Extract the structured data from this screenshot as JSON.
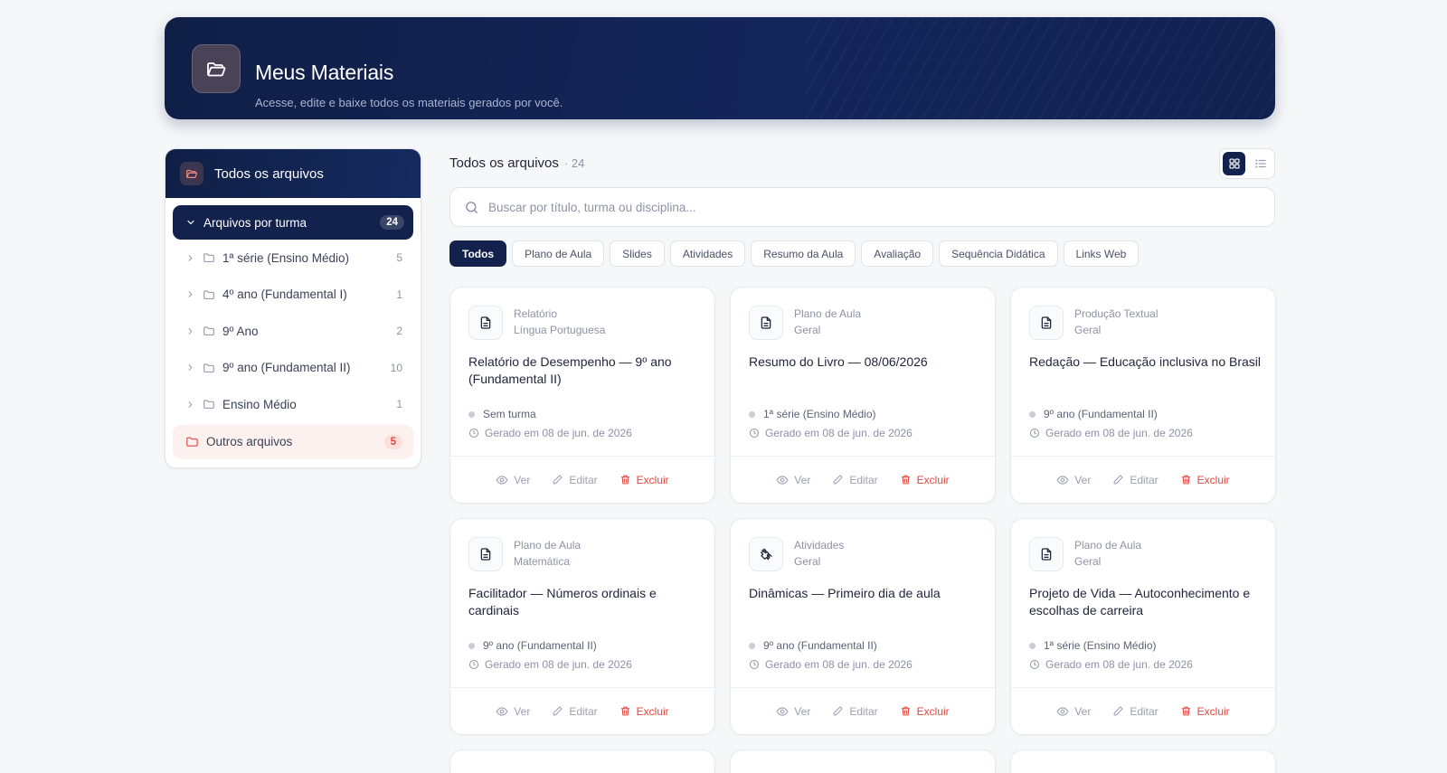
{
  "header": {
    "title": "Meus Materiais",
    "subtitle": "Acesse, edite e baixe todos os materiais gerados por você.",
    "icon": "folder-open-icon"
  },
  "sidebar": {
    "title": "Todos os arquivos",
    "group": {
      "label": "Arquivos por turma",
      "count": "24"
    },
    "items": [
      {
        "label": "1ª série (Ensino Médio)",
        "count": "5"
      },
      {
        "label": "4º ano (Fundamental I)",
        "count": "1"
      },
      {
        "label": "9º Ano",
        "count": "2"
      },
      {
        "label": "9º ano (Fundamental II)",
        "count": "10"
      },
      {
        "label": "Ensino Médio",
        "count": "1"
      }
    ],
    "other": {
      "label": "Outros arquivos",
      "count": "5"
    }
  },
  "main": {
    "title": "Todos os arquivos",
    "count": "· 24",
    "search_placeholder": "Buscar por título, turma ou disciplina...",
    "filters": [
      "Todos",
      "Plano de Aula",
      "Slides",
      "Atividades",
      "Resumo da Aula",
      "Avaliação",
      "Sequência Didática",
      "Links Web"
    ],
    "active_filter": "Todos",
    "actions": {
      "view": "Ver",
      "edit": "Editar",
      "delete": "Excluir"
    },
    "cards": [
      {
        "type": "Relatório",
        "subject": "Língua Portuguesa",
        "title": "Relatório de Desempenho — 9º ano (Fundamental II)",
        "class": "Sem turma",
        "date": "Gerado em 08 de jun. de 2026",
        "icon": "document-icon"
      },
      {
        "type": "Plano de Aula",
        "subject": "Geral",
        "title": "Resumo do Livro — 08/06/2026",
        "class": "1ª série (Ensino Médio)",
        "date": "Gerado em 08 de jun. de 2026",
        "icon": "document-icon"
      },
      {
        "type": "Produção Textual",
        "subject": "Geral",
        "title": "Redação — Educação inclusiva no Brasil",
        "class": "9º ano (Fundamental II)",
        "date": "Gerado em 08 de jun. de 2026",
        "icon": "document-icon"
      },
      {
        "type": "Plano de Aula",
        "subject": "Matemática",
        "title": "Facilitador — Números ordinais e cardinais",
        "class": "9º ano (Fundamental II)",
        "date": "Gerado em 08 de jun. de 2026",
        "icon": "document-icon"
      },
      {
        "type": "Atividades",
        "subject": "Geral",
        "title": "Dinâmicas — Primeiro dia de aula",
        "class": "9º ano (Fundamental II)",
        "date": "Gerado em 08 de jun. de 2026",
        "icon": "puzzle-icon"
      },
      {
        "type": "Plano de Aula",
        "subject": "Geral",
        "title": "Projeto de Vida — Autoconhecimento e escolhas de carreira",
        "class": "1ª série (Ensino Médio)",
        "date": "Gerado em 08 de jun. de 2026",
        "icon": "document-icon"
      }
    ]
  },
  "colors": {
    "navy": "#13224c",
    "danger": "#e0463f",
    "muted": "#8c93a4"
  }
}
